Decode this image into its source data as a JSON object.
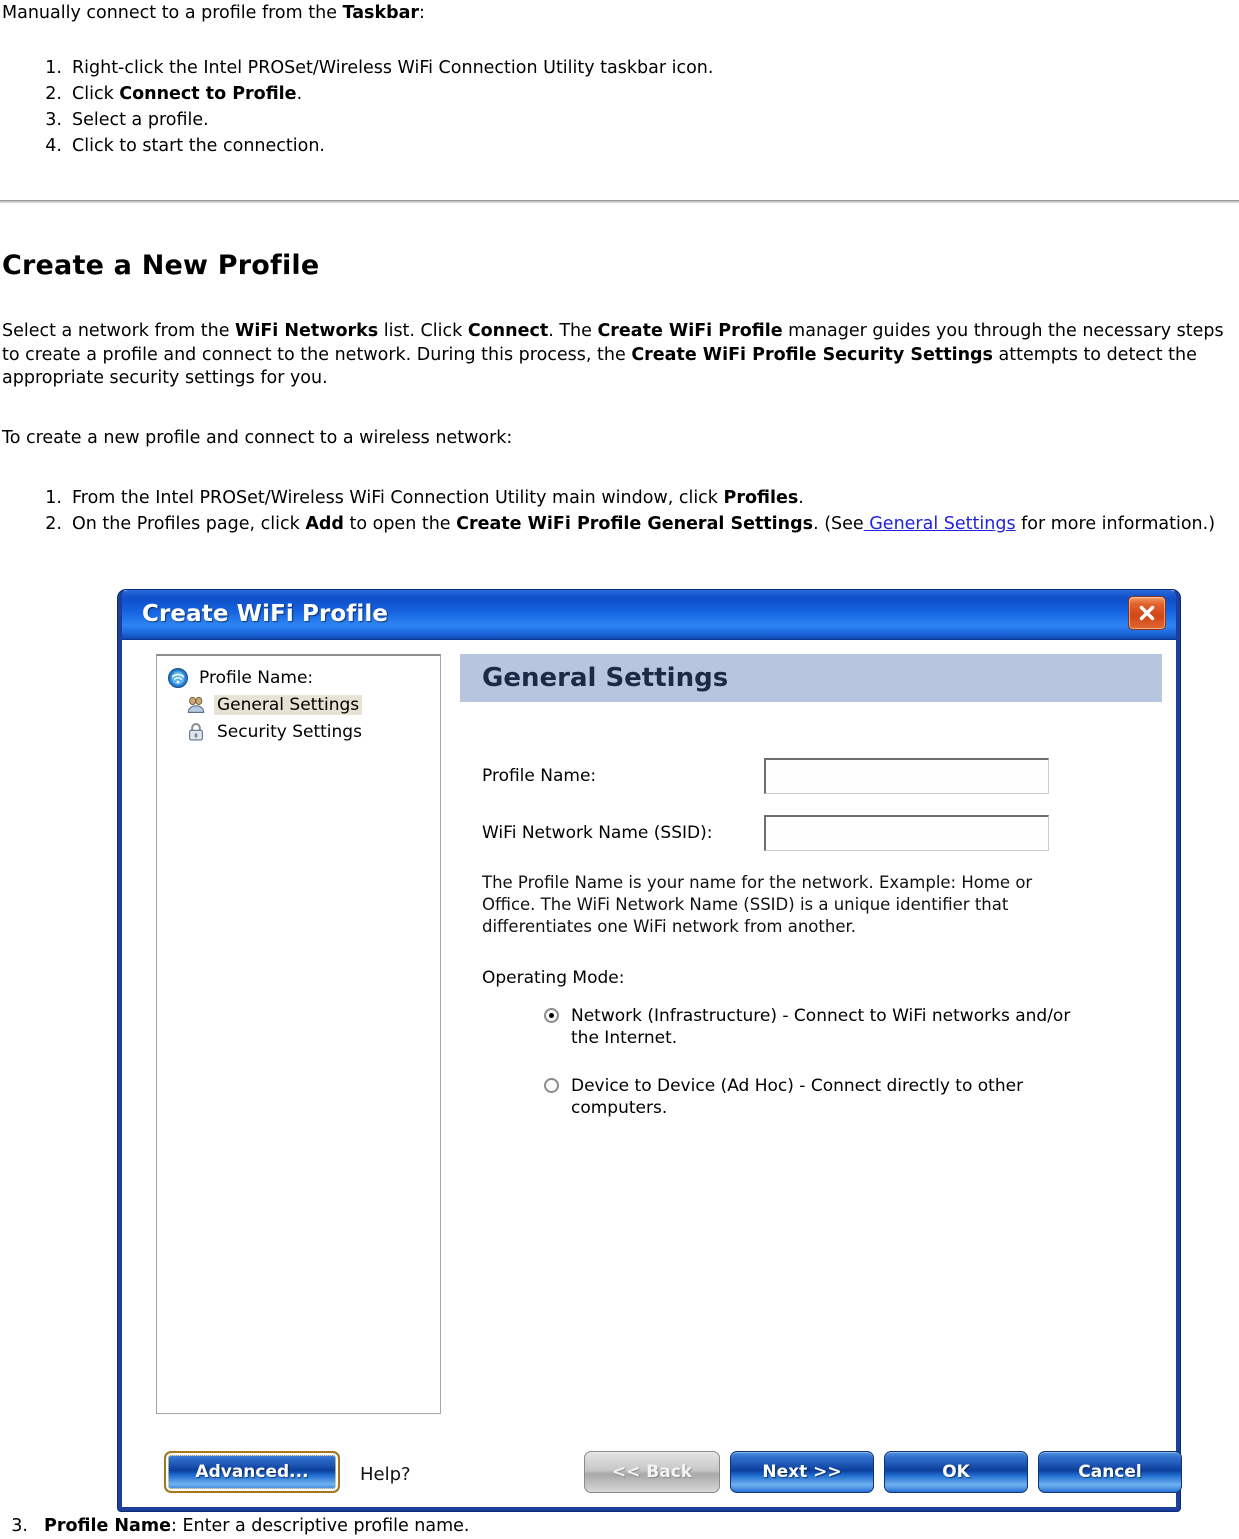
{
  "doc": {
    "intro_line": {
      "pre": "Manually connect to a profile from the ",
      "bold": "Taskbar",
      "post": ":"
    },
    "taskbar_steps": [
      {
        "num": "1.",
        "pre": "Right-click the Intel PROSet/Wireless WiFi Connection Utility taskbar icon.",
        "bold": "",
        "post": ""
      },
      {
        "num": "2.",
        "pre": "Click ",
        "bold": "Connect to Profile",
        "post": "."
      },
      {
        "num": "3.",
        "pre": "Select a profile.",
        "bold": "",
        "post": ""
      },
      {
        "num": "4.",
        "pre": "Click to start the connection.",
        "bold": "",
        "post": ""
      }
    ],
    "section_title": "Create a New Profile",
    "paragraph_1": {
      "s1": "Select a network from the ",
      "b1": "WiFi Networks",
      "s2": " list. Click ",
      "b2": "Connect",
      "s3": ". The ",
      "b3": "Create WiFi Profile",
      "s4": " manager guides you through the necessary steps to create a profile and connect to the network. During this process, the ",
      "b4": "Create WiFi Profile Security Settings",
      "s5": " attempts to detect the appropriate security settings for you."
    },
    "paragraph_2": "To create a new profile and connect to a wireless network:",
    "create_steps": [
      {
        "num": "1.",
        "s1": "From the Intel PROSet/Wireless WiFi Connection Utility main window, click ",
        "b1": "Profiles",
        "s2": ".",
        "b2": "",
        "s3": "",
        "link": "",
        "s4": ""
      },
      {
        "num": "2.",
        "s1": "On the Profiles page, click ",
        "b1": "Add",
        "s2": " to open the ",
        "b2": "Create WiFi Profile General Settings",
        "s3": ". (See",
        "link": " General Settings",
        "s4": " for more information.)"
      }
    ],
    "closing_step": {
      "num": "3.",
      "bold": "Profile Name",
      "text": ": Enter a descriptive profile name."
    }
  },
  "dialog": {
    "title": "Create WiFi Profile",
    "close_icon": "close-icon",
    "tree": {
      "items": [
        {
          "label": "Profile Name:",
          "icon": "wifi-globe-icon",
          "selected": false,
          "indent": false
        },
        {
          "label": "General Settings",
          "icon": "people-icon",
          "selected": true,
          "indent": true
        },
        {
          "label": "Security Settings",
          "icon": "padlock-icon",
          "selected": false,
          "indent": true
        }
      ]
    },
    "page": {
      "header": "General Settings",
      "fields": [
        {
          "label": "Profile Name:",
          "value": "",
          "placeholder": ""
        },
        {
          "label": "WiFi Network Name (SSID):",
          "value": "",
          "placeholder": ""
        }
      ],
      "help_text": "The Profile Name is your name for the network. Example: Home or Office. The WiFi Network Name (SSID) is a unique identifier that differentiates one WiFi network from another.",
      "operating_mode_label": "Operating Mode:",
      "operating_modes": [
        {
          "label": "Network (Infrastructure) - Connect to WiFi networks and/or the Internet.",
          "checked": true
        },
        {
          "label": "Device to Device (Ad Hoc) - Connect directly to other computers.",
          "checked": false
        }
      ]
    },
    "buttons": {
      "advanced": "Advanced...",
      "help": "Help?",
      "back": "<< Back",
      "next": "Next >>",
      "ok": "OK",
      "cancel": "Cancel"
    }
  },
  "colors": {
    "titlebar_blue": "#1f5fd4",
    "dialog_border": "#1b3f9b",
    "page_header": "#b7c5de",
    "selection_tan": "#e8e2d4",
    "link_blue": "#2222dd",
    "close_orange": "#cf4617"
  }
}
